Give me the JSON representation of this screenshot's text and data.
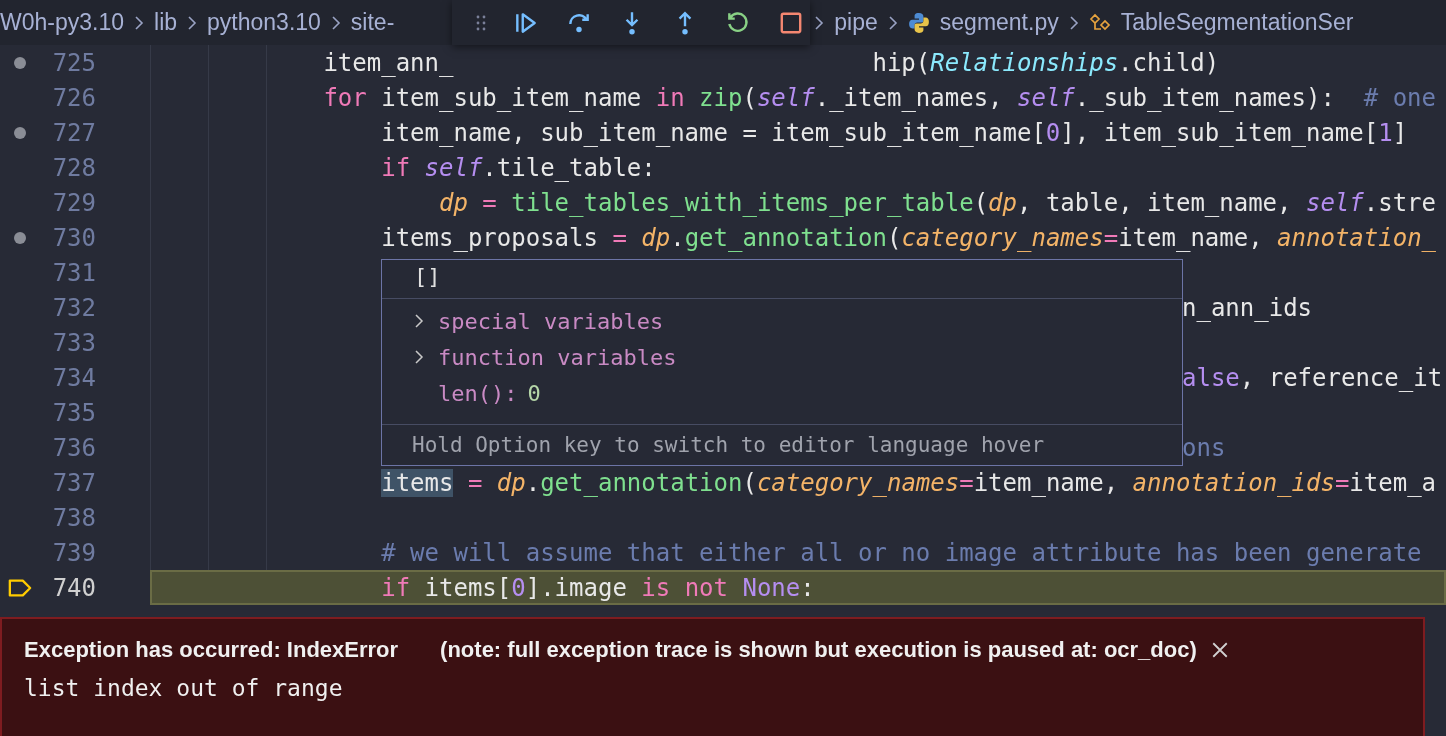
{
  "breadcrumb": [
    {
      "text": "W0h-py3.10",
      "kind": "folder"
    },
    {
      "text": "lib",
      "kind": "folder"
    },
    {
      "text": "python3.10",
      "kind": "folder"
    },
    {
      "text": "site-",
      "kind": "folder"
    },
    {
      "text": "pipe",
      "kind": "folder"
    },
    {
      "text": "segment.py",
      "kind": "python_file"
    },
    {
      "text": "TableSegmentationSer",
      "kind": "symbol"
    }
  ],
  "debug_toolbar": [
    {
      "kind": "continue"
    },
    {
      "kind": "step_over"
    },
    {
      "kind": "step_into"
    },
    {
      "kind": "step_out"
    },
    {
      "kind": "restart"
    },
    {
      "kind": "stop"
    }
  ],
  "lines": [
    {
      "number": "725",
      "breakpoint": true,
      "current": false,
      "tokens": [
        {
          "t": "            item_ann_",
          "kind": "plain"
        },
        {
          "t": "                             hip(",
          "kind": "plain"
        },
        {
          "t": "Relationships",
          "kind": "cls"
        },
        {
          "t": ".child)",
          "kind": "plain"
        }
      ]
    },
    {
      "number": "726",
      "breakpoint": false,
      "current": false,
      "tokens": [
        {
          "t": "            for",
          "kind": "kw"
        },
        {
          "t": " item_sub_item_name ",
          "kind": "plain"
        },
        {
          "t": "in",
          "kind": "kw"
        },
        {
          "t": " zip",
          "kind": "fn"
        },
        {
          "t": "(",
          "kind": "plain"
        },
        {
          "t": "self",
          "kind": "self"
        },
        {
          "t": "._item_names, ",
          "kind": "plain"
        },
        {
          "t": "self",
          "kind": "self"
        },
        {
          "t": "._sub_item_names):  ",
          "kind": "plain"
        },
        {
          "t": "# one",
          "kind": "cmt"
        }
      ]
    },
    {
      "number": "727",
      "breakpoint": true,
      "current": false,
      "tokens": [
        {
          "t": "                item_name, sub_item_name = item_sub_item_name[",
          "kind": "plain"
        },
        {
          "t": "0",
          "kind": "num"
        },
        {
          "t": "], item_sub_item_name[",
          "kind": "plain"
        },
        {
          "t": "1",
          "kind": "num"
        },
        {
          "t": "]",
          "kind": "plain"
        }
      ]
    },
    {
      "number": "728",
      "breakpoint": false,
      "current": false,
      "tokens": [
        {
          "t": "                if",
          "kind": "kw"
        },
        {
          "t": " self",
          "kind": "self"
        },
        {
          "t": ".tile_table:",
          "kind": "plain"
        }
      ]
    },
    {
      "number": "729",
      "breakpoint": false,
      "current": false,
      "tokens": [
        {
          "t": "                    dp",
          "kind": "var"
        },
        {
          "t": " = ",
          "kind": "op"
        },
        {
          "t": "tile_tables_with_items_per_table",
          "kind": "fn"
        },
        {
          "t": "(",
          "kind": "plain"
        },
        {
          "t": "dp",
          "kind": "var"
        },
        {
          "t": ", table, item_name, ",
          "kind": "plain"
        },
        {
          "t": "self",
          "kind": "self"
        },
        {
          "t": ".stre",
          "kind": "plain"
        }
      ]
    },
    {
      "number": "730",
      "breakpoint": true,
      "current": false,
      "tokens": [
        {
          "t": "                items_proposals ",
          "kind": "plain"
        },
        {
          "t": "=",
          "kind": "op"
        },
        {
          "t": " dp",
          "kind": "var"
        },
        {
          "t": ".",
          "kind": "plain"
        },
        {
          "t": "get_annotation",
          "kind": "fn"
        },
        {
          "t": "(",
          "kind": "plain"
        },
        {
          "t": "category_names",
          "kind": "param"
        },
        {
          "t": "=",
          "kind": "op"
        },
        {
          "t": "item_name, ",
          "kind": "plain"
        },
        {
          "t": "annotation_",
          "kind": "param"
        }
      ]
    },
    {
      "number": "731",
      "breakpoint": false,
      "current": false
    },
    {
      "number": "732",
      "breakpoint": false,
      "current": false,
      "kind": "covered",
      "tokens": [
        {
          "t": "n_ann_ids",
          "kind": "plain"
        }
      ]
    },
    {
      "number": "733",
      "breakpoint": false,
      "current": false
    },
    {
      "number": "734",
      "breakpoint": false,
      "current": false,
      "kind": "covered",
      "tokens": [
        {
          "t": "alse",
          "kind": "const"
        },
        {
          "t": ", reference_it",
          "kind": "plain"
        }
      ]
    },
    {
      "number": "735",
      "breakpoint": false,
      "current": false
    },
    {
      "number": "736",
      "breakpoint": false,
      "current": false,
      "kind": "covered",
      "tokens": [
        {
          "t": "ons",
          "kind": "cmt"
        }
      ]
    },
    {
      "number": "737",
      "breakpoint": false,
      "current": false,
      "tokens": [
        {
          "t": "                items",
          "kind": "hl"
        },
        {
          "t": " =",
          "kind": "op"
        },
        {
          "t": " dp",
          "kind": "var"
        },
        {
          "t": ".",
          "kind": "plain"
        },
        {
          "t": "get_annotation",
          "kind": "fn"
        },
        {
          "t": "(",
          "kind": "plain"
        },
        {
          "t": "category_names",
          "kind": "param"
        },
        {
          "t": "=",
          "kind": "op"
        },
        {
          "t": "item_name, ",
          "kind": "plain"
        },
        {
          "t": "annotation_ids",
          "kind": "param"
        },
        {
          "t": "=",
          "kind": "op"
        },
        {
          "t": "item_a",
          "kind": "plain"
        }
      ]
    },
    {
      "number": "738",
      "breakpoint": false,
      "current": false
    },
    {
      "number": "739",
      "breakpoint": false,
      "current": false,
      "tokens": [
        {
          "t": "                # we will assume that either all or no image attribute has been generate",
          "kind": "cmt"
        }
      ]
    },
    {
      "number": "740",
      "breakpoint": false,
      "current": true,
      "tokens": [
        {
          "t": "                if",
          "kind": "kw"
        },
        {
          "t": " items[",
          "kind": "plain"
        },
        {
          "t": "0",
          "kind": "num"
        },
        {
          "t": "].image ",
          "kind": "plain"
        },
        {
          "t": "is not",
          "kind": "kw"
        },
        {
          "t": " None",
          "kind": "const"
        },
        {
          "t": ":",
          "kind": "plain"
        }
      ]
    }
  ],
  "hover": {
    "header": "[]",
    "rows": [
      {
        "kind": "group",
        "label": "special variables"
      },
      {
        "kind": "group",
        "label": "function variables"
      },
      {
        "kind": "value",
        "label": "len():",
        "value": "0"
      }
    ],
    "footer": "Hold Option key to switch to editor language hover"
  },
  "exception": {
    "title": "Exception has occurred: IndexError",
    "note": "(note: full exception trace is shown but execution is paused at: ocr_doc)",
    "message": "list index out of range"
  }
}
